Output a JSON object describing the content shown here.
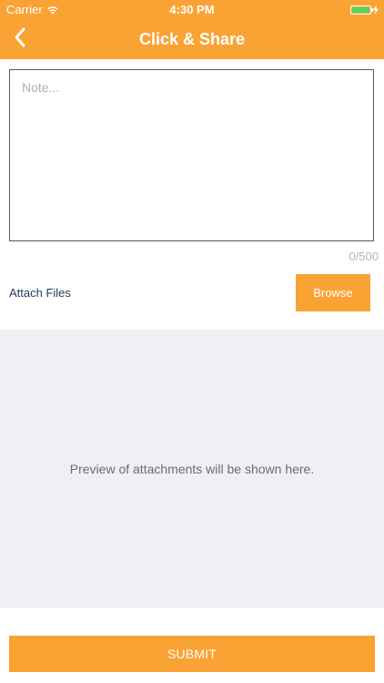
{
  "status_bar": {
    "carrier": "Carrier",
    "time": "4:30 PM",
    "battery_level": 1.0,
    "battery_color": "#4cd964"
  },
  "nav": {
    "back_icon": "chevron-left-icon",
    "title": "Click & Share"
  },
  "note": {
    "placeholder": "Note...",
    "value": "",
    "counter": "0/500"
  },
  "attach": {
    "label": "Attach Files",
    "browse_label": "Browse"
  },
  "preview": {
    "message": "Preview of attachments will be shown here."
  },
  "submit": {
    "label": "SUBMIT"
  },
  "colors": {
    "accent": "#f9a334",
    "preview_background": "#efeff4",
    "link_text": "#1f3a5c"
  }
}
